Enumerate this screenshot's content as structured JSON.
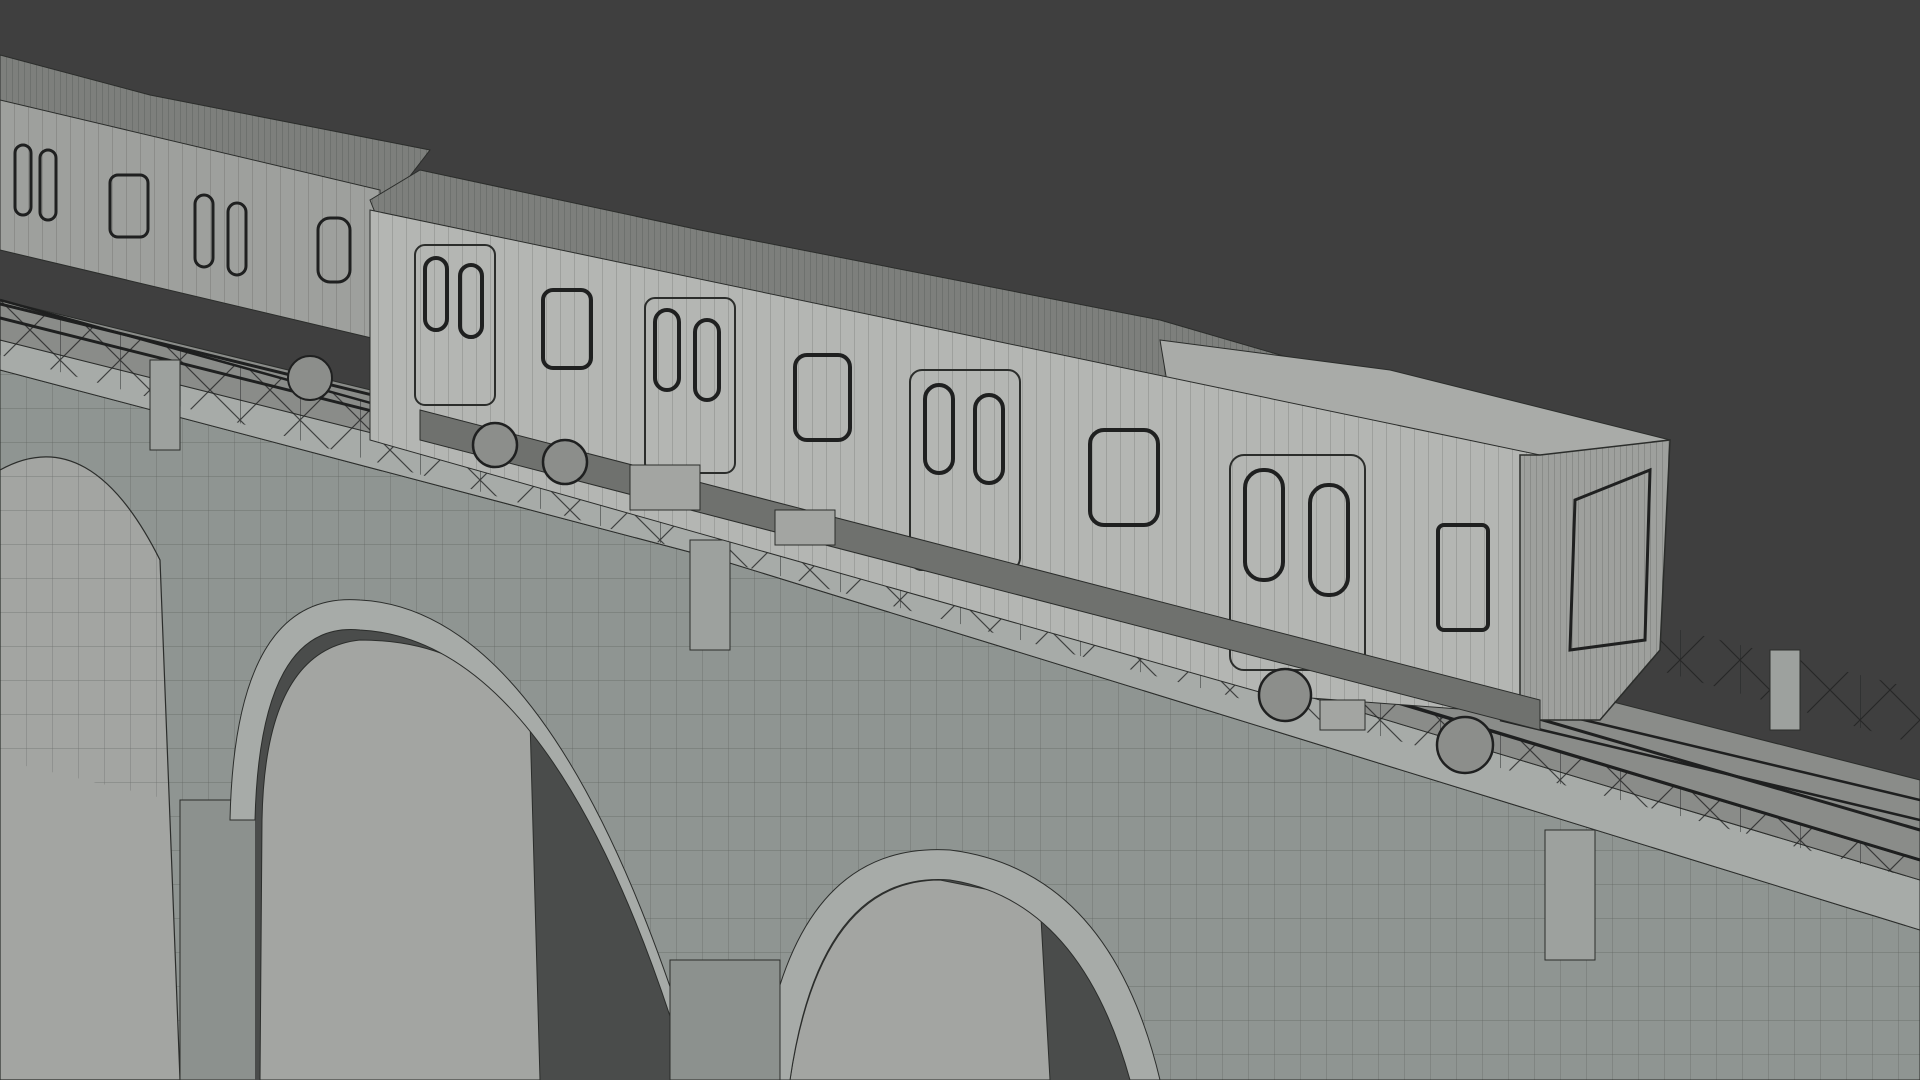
{
  "viewport": {
    "background": "#3f3f3f",
    "render_style": "wireframe-on-shaded"
  },
  "scene": {
    "subject": "subway-train-on-arched-viaduct",
    "colors": {
      "train_body": "#9ea09d",
      "train_body_light": "#b4b6b3",
      "train_roof": "#7d7f7c",
      "wire": "#2b2d2b",
      "viaduct_face": "#8f9592",
      "viaduct_light": "#a7aba8",
      "arch_shadow": "#4a4c4b",
      "arch_inner": "#a3a5a2",
      "deck": "#8a8c89",
      "rail": "#1f2020"
    }
  }
}
